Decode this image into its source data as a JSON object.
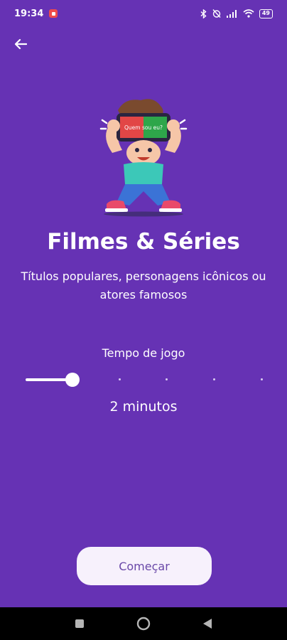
{
  "status_bar": {
    "time": "19:34",
    "battery": "49",
    "icons": [
      "record-icon",
      "bluetooth-icon",
      "alarm-off-icon",
      "signal-icon",
      "wifi-icon",
      "battery-icon"
    ]
  },
  "header": {
    "back_icon": "arrow-left-icon"
  },
  "category": {
    "title": "Filmes & Séries",
    "description": "Títulos populares, personagens icônicos ou atores famosos",
    "illustration_screen_text": "Quem sou eu?"
  },
  "timer": {
    "label": "Tempo de jogo",
    "value_text": "2 minutos",
    "slider_steps": 6,
    "slider_selected_index": 0
  },
  "actions": {
    "start_label": "Começar"
  },
  "colors": {
    "background": "#6632b4",
    "button_bg": "#f7f1fc",
    "button_text": "#6a48a8"
  }
}
